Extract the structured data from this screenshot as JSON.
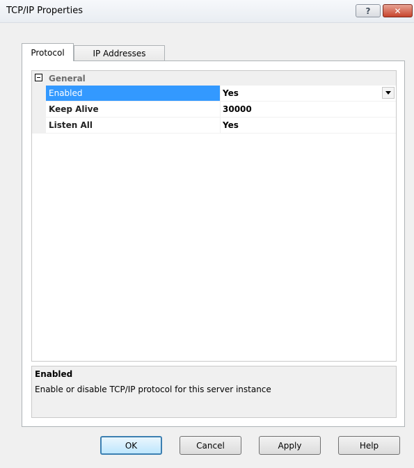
{
  "window": {
    "title": "TCP/IP Properties",
    "help_glyph": "?",
    "close_glyph": "✕"
  },
  "tabs": [
    {
      "label": "Protocol",
      "active": true
    },
    {
      "label": "IP Addresses",
      "active": false
    }
  ],
  "grid": {
    "category": "General",
    "rows": [
      {
        "name": "Enabled",
        "value": "Yes",
        "selected": true,
        "has_dropdown": true
      },
      {
        "name": "Keep Alive",
        "value": "30000",
        "selected": false
      },
      {
        "name": "Listen All",
        "value": "Yes",
        "selected": false
      }
    ]
  },
  "description": {
    "title": "Enabled",
    "text": "Enable or disable TCP/IP protocol for this server instance"
  },
  "buttons": {
    "ok": "OK",
    "cancel": "Cancel",
    "apply": "Apply",
    "help": "Help"
  },
  "colors": {
    "selection": "#3399ff",
    "close_button": "#c7442c"
  }
}
